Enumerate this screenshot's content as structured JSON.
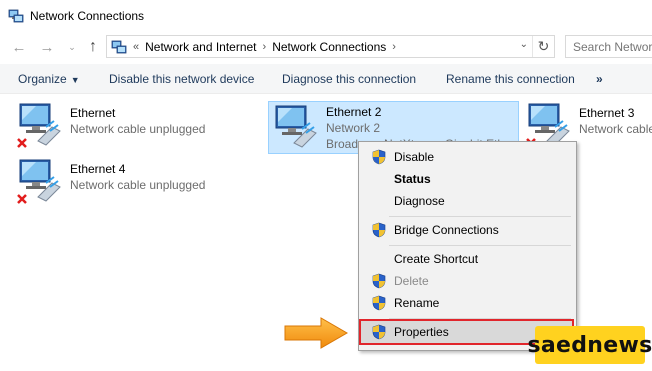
{
  "window": {
    "title": "Network Connections"
  },
  "address_bar": {
    "overflow": "«",
    "crumbs": [
      "Network and Internet",
      "Network Connections"
    ],
    "search_placeholder": "Search Network Connections"
  },
  "toolbar": {
    "organize": "Organize",
    "disable": "Disable this network device",
    "diagnose": "Diagnose this connection",
    "rename": "Rename this connection",
    "more": "»"
  },
  "connections": [
    {
      "name": "Ethernet",
      "status": "Network cable unplugged",
      "device": "",
      "unplugged": true,
      "selected": false
    },
    {
      "name": "Ethernet 2",
      "status": "Network  2",
      "device": "Broadcom NetXtreme Gigabit Ethernet",
      "unplugged": false,
      "selected": true
    },
    {
      "name": "Ethernet 3",
      "status": "Network cable unplugged",
      "device": "",
      "unplugged": true,
      "selected": false
    },
    {
      "name": "Ethernet 4",
      "status": "Network cable unplugged",
      "device": "",
      "unplugged": true,
      "selected": false
    }
  ],
  "context_menu": {
    "disable": "Disable",
    "status": "Status",
    "diagnose": "Diagnose",
    "bridge": "Bridge Connections",
    "shortcut": "Create Shortcut",
    "delete": "Delete",
    "rename": "Rename",
    "properties": "Properties"
  },
  "watermark": "saednews",
  "colors": {
    "selection_bg": "#cce8ff",
    "highlight_border": "#e1262c",
    "arrow": "#f7a21b",
    "watermark_bg": "#ffd21f"
  }
}
